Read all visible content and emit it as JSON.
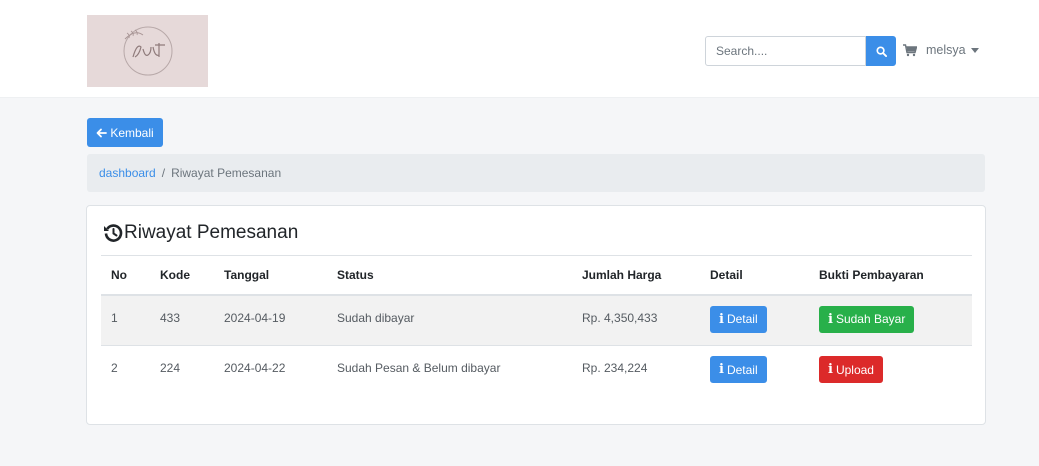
{
  "header": {
    "search": {
      "placeholder": "Search...."
    },
    "user": {
      "name": "melsya"
    }
  },
  "back_button": {
    "label": "Kembali"
  },
  "breadcrumb": {
    "link": "dashboard",
    "separator": "/",
    "current": "Riwayat Pemesanan"
  },
  "card": {
    "title": "Riwayat Pemesanan"
  },
  "table": {
    "headers": [
      "No",
      "Kode",
      "Tanggal",
      "Status",
      "Jumlah Harga",
      "Detail",
      "Bukti Pembayaran"
    ],
    "rows": [
      {
        "no": "1",
        "kode": "433",
        "tanggal": "2024-04-19",
        "status": "Sudah dibayar",
        "harga": "Rp. 4,350,433",
        "detail_label": "Detail",
        "bukti_label": "Sudah Bayar",
        "bukti_color": "#28b04a"
      },
      {
        "no": "2",
        "kode": "224",
        "tanggal": "2024-04-22",
        "status": "Sudah Pesan & Belum dibayar",
        "harga": "Rp. 234,224",
        "detail_label": "Detail",
        "bukti_label": "Upload",
        "bukti_color": "#dc2a2a"
      }
    ]
  },
  "colors": {
    "primary": "#3b8ee8",
    "success": "#28b04a",
    "danger": "#dc2a2a",
    "breadcrumb_bg": "#e9ecef"
  },
  "icons": {
    "logo": "brand-logo",
    "search": "search-icon",
    "cart": "cart-icon",
    "back": "arrow-left-icon",
    "history": "history-icon",
    "info": "info-icon"
  }
}
